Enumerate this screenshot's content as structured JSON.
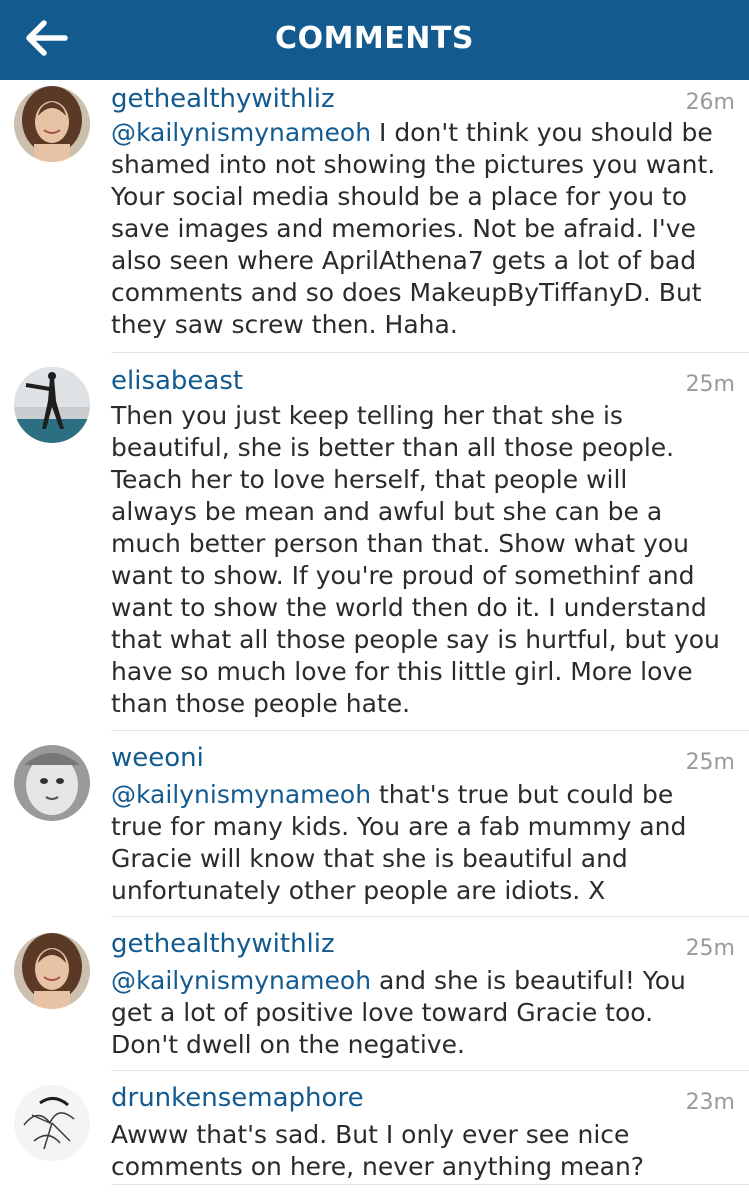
{
  "header": {
    "title": "COMMENTS",
    "back_icon": "arrow-left-icon",
    "background": "#135a8f"
  },
  "comments": [
    {
      "username": "gethealthywithliz",
      "time": "26m",
      "mention": "@kailynismynameoh",
      "text": " I don't think you should be\nshamed into not showing the pictures you want.\nYour social media should be a place for you to\nsave images and memories. Not be afraid. I've\nalso seen where AprilAthena7 gets a lot of bad\ncomments and so does MakeupByTiffanyD. But\nthey saw screw then. Haha."
    },
    {
      "username": "elisabeast",
      "time": "25m",
      "mention": "",
      "text": "Then you just keep telling her that she is\nbeautiful, she is better than all those people.\nTeach her to love herself, that people will\nalways be mean and awful but she can be a\nmuch better person than that. Show what you\nwant to show. If you're proud of somethinf and\nwant to show the world then do it. I understand\nthat what all those people say is hurtful, but you\nhave so much  love for this little girl. More love\nthan those people hate."
    },
    {
      "username": "weeoni",
      "time": "25m",
      "mention": "@kailynismynameoh",
      "text": " that's true but could be\ntrue for many kids. You are a fab mummy and\nGracie will know that she is beautiful and\nunfortunately other people are idiots. X"
    },
    {
      "username": "gethealthywithliz",
      "time": "25m",
      "mention": "@kailynismynameoh",
      "text": " and she is beautiful! You\nget a lot of positive love toward Gracie too.\nDon't dwell on the negative."
    },
    {
      "username": "drunkensemaphore",
      "time": "23m",
      "mention": "",
      "text": "Awww that's sad. But I only ever see nice\ncomments on here, never anything mean?"
    }
  ]
}
